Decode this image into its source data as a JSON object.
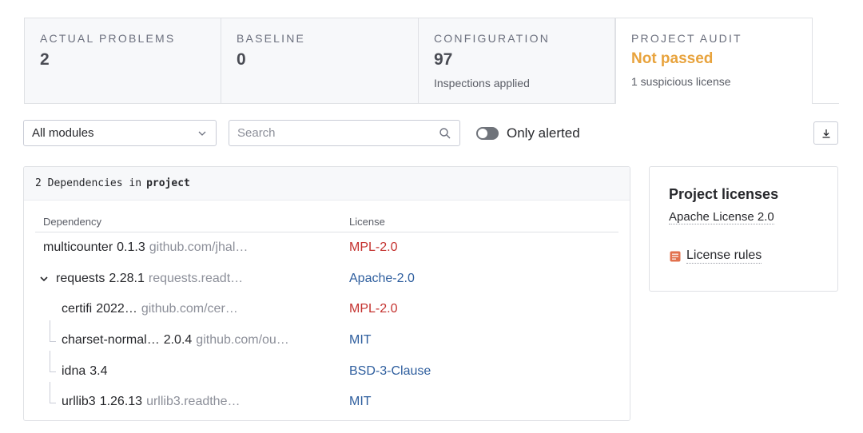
{
  "cards": [
    {
      "title": "ACTUAL PROBLEMS",
      "value": "2",
      "sub": ""
    },
    {
      "title": "BASELINE",
      "value": "0",
      "sub": ""
    },
    {
      "title": "CONFIGURATION",
      "value": "97",
      "sub": "Inspections applied"
    },
    {
      "title": "PROJECT AUDIT",
      "value": "Not passed",
      "sub": "1 suspicious license"
    }
  ],
  "toolbar": {
    "module_select": "All modules",
    "search_placeholder": "Search",
    "toggle_label": "Only alerted",
    "toggle_on": false
  },
  "deps": {
    "count": "2",
    "header_text": "Dependencies in",
    "header_scope": "project",
    "col_dependency": "Dependency",
    "col_license": "License",
    "rows": [
      {
        "name": "multicounter",
        "version": "0.1.3",
        "source": "github.com/jhal…",
        "license": "MPL-2.0",
        "level": 0
      },
      {
        "name": "requests",
        "version": "2.28.1",
        "source": "requests.readt…",
        "license": "Apache-2.0",
        "level": 0
      },
      {
        "name": "certifi",
        "version": "2022…",
        "source": "github.com/cer…",
        "license": "MPL-2.0",
        "level": 1
      },
      {
        "name": "charset-normal…",
        "version": "2.0.4",
        "source": "github.com/ou…",
        "license": "MIT",
        "level": 1
      },
      {
        "name": "idna",
        "version": "3.4",
        "source": "",
        "license": "BSD-3-Clause",
        "level": 1
      },
      {
        "name": "urllib3",
        "version": "1.26.13",
        "source": "urllib3.readthe…",
        "license": "MIT",
        "level": 1
      }
    ]
  },
  "licenses": {
    "title": "Project licenses",
    "name": "Apache License 2.0",
    "rules_label": "License rules"
  },
  "colors": {
    "warn": "#e8a33d",
    "license_red": "#c4312e",
    "license_blue": "#2e5e9e"
  }
}
